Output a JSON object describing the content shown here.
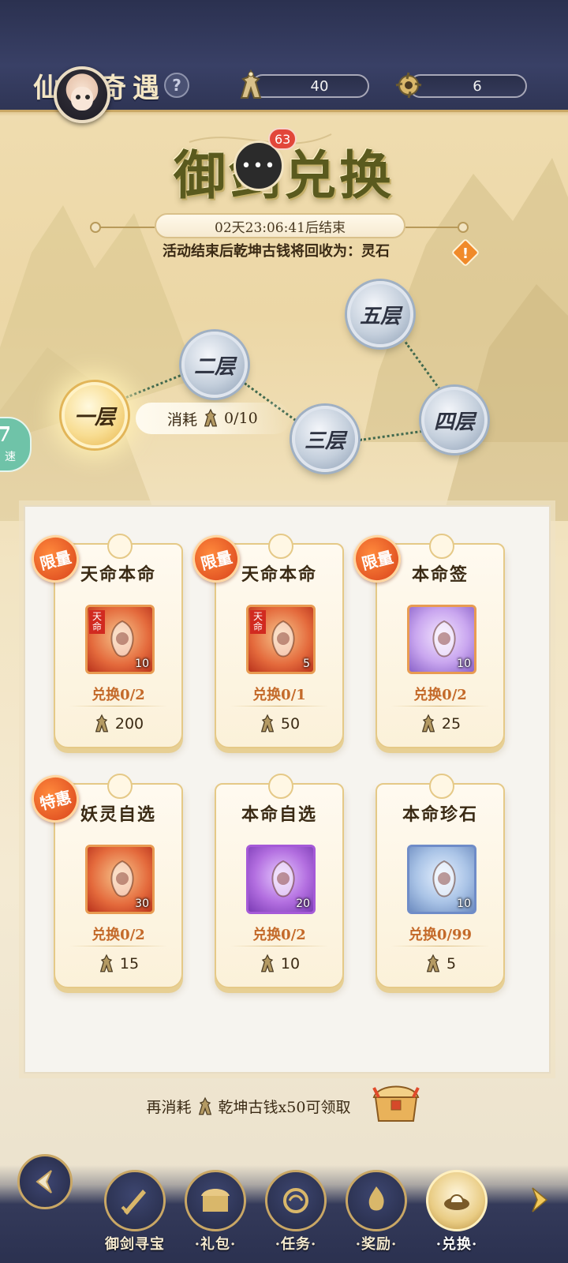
{
  "header": {
    "title": "仙缘奇遇",
    "help_label": "?",
    "currencies": [
      {
        "icon": "ancient-coin-icon",
        "value": "40"
      },
      {
        "icon": "spirit-token-icon",
        "value": "6"
      }
    ]
  },
  "banner": {
    "title": "御剑兑换",
    "chat_badge": "63",
    "chat_dots": "•••",
    "timer": "02天23:06:41后结束",
    "notice": "活动结束后乾坤古钱将回收为：灵石",
    "warning_label": "!"
  },
  "floors": {
    "items": [
      {
        "label": "一层",
        "active": true
      },
      {
        "label": "二层",
        "active": false
      },
      {
        "label": "三层",
        "active": false
      },
      {
        "label": "四层",
        "active": false
      },
      {
        "label": "五层",
        "active": false
      }
    ],
    "cost_label": "消耗",
    "cost_value": "0/10",
    "side_chip_label": "速",
    "side_chip_number": "7"
  },
  "shop": {
    "items": [
      {
        "tag": "限量",
        "name": "天命本命",
        "count": "10",
        "exchange": "兑换0/2",
        "price": "200",
        "side_label": "天命",
        "color": "red"
      },
      {
        "tag": "限量",
        "name": "天命本命",
        "count": "5",
        "exchange": "兑换0/1",
        "price": "50",
        "side_label": "天命",
        "color": "red"
      },
      {
        "tag": "限量",
        "name": "本命签",
        "count": "10",
        "exchange": "兑换0/2",
        "price": "25",
        "side_label": "",
        "color": "purple"
      },
      {
        "tag": "特惠",
        "name": "妖灵自选",
        "count": "30",
        "exchange": "兑换0/2",
        "price": "15",
        "side_label": "",
        "color": "red"
      },
      {
        "tag": "",
        "name": "本命自选",
        "count": "20",
        "exchange": "兑换0/2",
        "price": "10",
        "side_label": "",
        "color": "violet"
      },
      {
        "tag": "",
        "name": "本命珍石",
        "count": "10",
        "exchange": "兑换0/99",
        "price": "5",
        "side_label": "",
        "color": "blue"
      }
    ]
  },
  "reward": {
    "prefix": "再消耗",
    "suffix": "乾坤古钱x50可领取"
  },
  "nav": {
    "items": [
      {
        "label": "御剑寻宝",
        "icon": "sword-icon",
        "active": false
      },
      {
        "label": "·礼包·",
        "icon": "gift-chest-icon",
        "active": false
      },
      {
        "label": "·任务·",
        "icon": "task-scroll-icon",
        "active": false
      },
      {
        "label": "·奖励·",
        "icon": "flame-reward-icon",
        "active": false
      },
      {
        "label": "·兑换·",
        "icon": "exchange-icon",
        "active": true
      }
    ]
  },
  "colors": {
    "header_bg": "#343a5a",
    "gold_accent": "#c9a765",
    "tag_orange": "#e0521f",
    "exchange_text": "#c46a2a",
    "path_green": "#41694e"
  }
}
